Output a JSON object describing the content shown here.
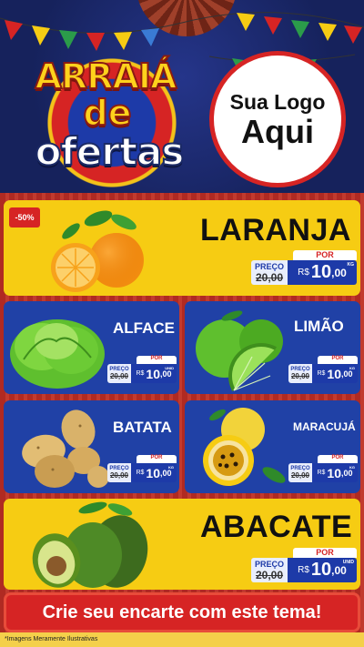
{
  "header": {
    "title_line1": "ARRAIÁ",
    "title_line2": "de",
    "title_line3": "ofertas",
    "logo_line1": "Sua Logo",
    "logo_line2": "Aqui"
  },
  "products": [
    {
      "name": "LARANJA",
      "discount": "-50%",
      "por": "POR",
      "preco_label": "PREÇO",
      "old_prefix": "de",
      "old_price": "20,00",
      "currency": "R$",
      "price_int": "10",
      "price_dec": ",00",
      "unit": "KG"
    },
    {
      "name": "ALFACE",
      "por": "POR",
      "preco_label": "PREÇO",
      "old_prefix": "de",
      "old_price": "20,00",
      "currency": "R$",
      "price_int": "10",
      "price_dec": ",00",
      "unit": "UNID"
    },
    {
      "name": "LIMÃO",
      "por": "POR",
      "preco_label": "PREÇO",
      "old_prefix": "de",
      "old_price": "20,00",
      "currency": "R$",
      "price_int": "10",
      "price_dec": ",00",
      "unit": "KG"
    },
    {
      "name": "BATATA",
      "por": "POR",
      "preco_label": "PREÇO",
      "old_prefix": "de",
      "old_price": "20,00",
      "currency": "R$",
      "price_int": "10",
      "price_dec": ",00",
      "unit": "KG"
    },
    {
      "name": "MARACUJÁ",
      "por": "POR",
      "preco_label": "PREÇO",
      "old_prefix": "de",
      "old_price": "20,00",
      "currency": "R$",
      "price_int": "10",
      "price_dec": ",00",
      "unit": "KG"
    },
    {
      "name": "ABACATE",
      "por": "POR",
      "preco_label": "PREÇO",
      "old_prefix": "de",
      "old_price": "20,00",
      "currency": "R$",
      "price_int": "10",
      "price_dec": ",00",
      "unit": "UNID"
    }
  ],
  "cta": "Crie seu encarte com este tema!",
  "footer_note": "*Imagens Meramente Ilustrativas",
  "colors": {
    "yellow": "#f6cc13",
    "blue": "#2041a6",
    "red": "#d62424",
    "navy": "#1b2a66"
  }
}
